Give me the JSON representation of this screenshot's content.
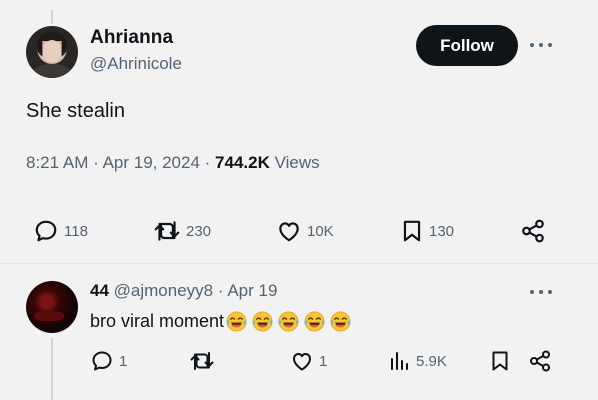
{
  "tweet": {
    "author_name": "Ahrianna",
    "author_handle": "@Ahrinicole",
    "follow_label": "Follow",
    "text": "She stealin",
    "time": "8:21 AM",
    "date": "Apr 19, 2024",
    "views_count": "744.2K",
    "views_label": "Views",
    "actions": {
      "replies": "118",
      "reposts": "230",
      "likes": "10K",
      "bookmarks": "130"
    }
  },
  "reply": {
    "author_name": "44",
    "author_handle": "@ajmoneyy8",
    "date": "Apr 19",
    "text": "bro viral moment",
    "emoji_name": "face-with-tears-of-joy",
    "emoji_count": 5,
    "actions": {
      "replies": "1",
      "reposts": "",
      "likes": "1",
      "views": "5.9K"
    }
  },
  "icons": {
    "reply": "reply-icon",
    "repost": "repost-icon",
    "like": "heart-icon",
    "bookmark": "bookmark-icon",
    "share": "share-icon",
    "views": "views-icon",
    "more": "more-icon"
  },
  "colors": {
    "background": "#f2f2f2",
    "text": "#0f1419",
    "secondary_text": "#536471",
    "follow_button": "#0f1419"
  }
}
